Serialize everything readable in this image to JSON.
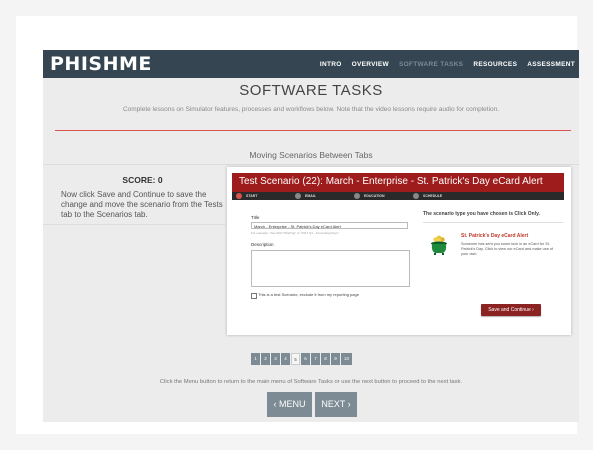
{
  "header": {
    "logo": "PHISHME",
    "nav": [
      {
        "label": "INTRO",
        "dim": false
      },
      {
        "label": "OVERVIEW",
        "dim": false
      },
      {
        "label": "SOFTWARE TASKS",
        "dim": true
      },
      {
        "label": "RESOURCES",
        "dim": false
      },
      {
        "label": "ASSESSMENT",
        "dim": false
      }
    ]
  },
  "page": {
    "title": "SOFTWARE TASKS",
    "intro": "Complete lessons on Simulator features, processes and workflows below. Note that the video lessons require audio for completion.",
    "lesson_title": "Moving Scenarios Between Tabs"
  },
  "left_panel": {
    "score": "SCORE: 0",
    "instruction": "Now click Save and Continue to save the change and move the scenario from the Tests tab to the Scenarios tab."
  },
  "simulator": {
    "title": "Test Scenario (22): March - Enterprise - St. Patrick's Day eCard Alert",
    "steps": [
      {
        "label": "START",
        "active": true
      },
      {
        "label": "EMAIL",
        "active": false
      },
      {
        "label": "EDUCATION",
        "active": false
      },
      {
        "label": "SCHEDULE",
        "active": false
      }
    ],
    "title_label": "Title",
    "title_value": "March - Enterprise - St. Patrick's Day eCard Alert",
    "title_hint": "For example: \"Jan 2017 Phishing\" or \"2017 Q1 - Accounting Dept.\"",
    "description_label": "Description",
    "checkbox_label": "This is a test Scenario; exclude it from my reporting page",
    "right_heading": "The scenario type you have chosen is Click Only.",
    "ecard_title": "St. Patrick's Day eCard Alert",
    "ecard_desc": "Someone has sent you some luck in an eCard for St. Patrick's Day. Click to view our eCard and make use of your own.",
    "save_button": "Save and Continue ›",
    "colors": {
      "header": "#9e1c1c",
      "save": "#8b2323"
    }
  },
  "pagination": {
    "pages": [
      "1",
      "2",
      "3",
      "4",
      "5",
      "6",
      "7",
      "8",
      "9",
      "10"
    ],
    "current": "5"
  },
  "footer": {
    "text": "Click the Menu button to return to the main menu of Software Tasks or use the next button to proceed to the next task.",
    "menu_button": "‹ MENU",
    "next_button": "NEXT ›"
  }
}
